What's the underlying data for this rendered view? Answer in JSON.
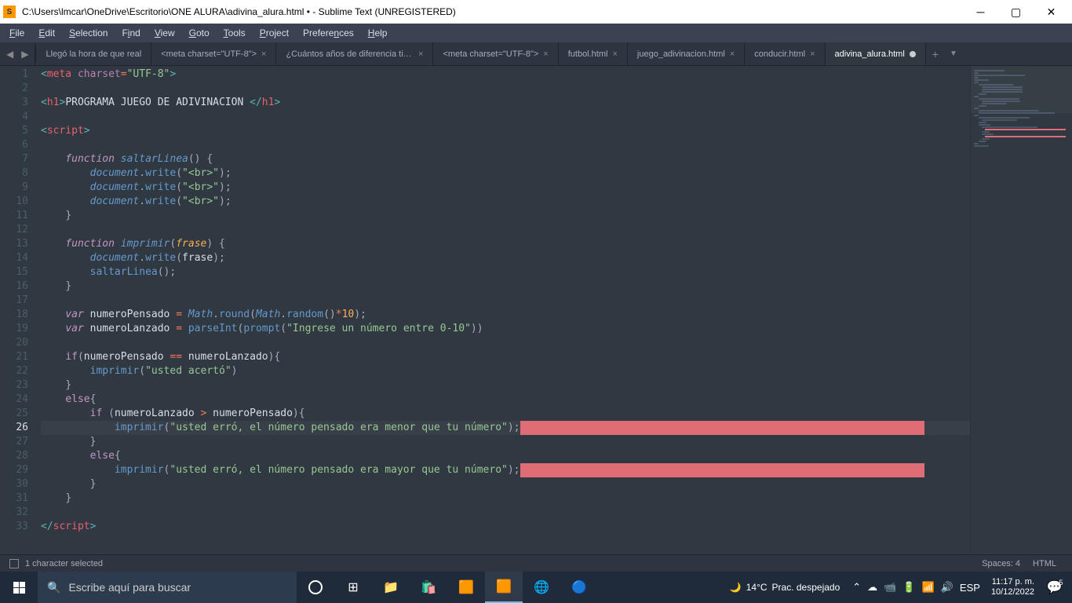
{
  "titlebar": {
    "path": "C:\\Users\\lmcar\\OneDrive\\Escritorio\\ONE ALURA\\adivina_alura.html • - Sublime Text (UNREGISTERED)"
  },
  "menu": [
    "File",
    "Edit",
    "Selection",
    "Find",
    "View",
    "Goto",
    "Tools",
    "Project",
    "Preferences",
    "Help"
  ],
  "tabs": [
    {
      "label": "Llegó la hora de que real",
      "close": false
    },
    {
      "label": "<meta charset=\"UTF-8\">",
      "close": true
    },
    {
      "label": "¿Cuántos años de diferencia tienes con tu hermano?",
      "close": true
    },
    {
      "label": "<meta charset=\"UTF-8\">",
      "close": true
    },
    {
      "label": "futbol.html",
      "close": true
    },
    {
      "label": "juego_adivinacion.html",
      "close": true
    },
    {
      "label": "conducir.html",
      "close": true
    },
    {
      "label": "adivina_alura.html",
      "dirty": true,
      "active": true
    }
  ],
  "lines": 33,
  "current_line": 26,
  "code": {
    "l1_meta": {
      "tag": "meta",
      "attr": "charset",
      "val": "\"UTF-8\""
    },
    "l3_h1": {
      "open": "h1",
      "text": "PROGRAMA JUEGO DE ADIVINACION ",
      "close": "h1"
    },
    "l5_script": "script",
    "l7_func": {
      "kw": "function",
      "name": "saltarLinea"
    },
    "l8_10": {
      "obj": "document",
      "method": "write",
      "arg": "\"<br>\""
    },
    "l13_func": {
      "kw": "function",
      "name": "imprimir",
      "param": "frase"
    },
    "l14": {
      "obj": "document",
      "method": "write",
      "arg": "frase"
    },
    "l15": {
      "call": "saltarLinea"
    },
    "l18": {
      "kw": "var",
      "name": "numeroPensado",
      "math": "Math",
      "round": "round",
      "random": "random",
      "num": "10"
    },
    "l19": {
      "kw": "var",
      "name": "numeroLanzado",
      "parse": "parseInt",
      "prompt": "prompt",
      "str": "\"Ingrese un número entre 0-10\""
    },
    "l21_if": {
      "kw": "if",
      "a": "numeroPensado",
      "op": "==",
      "b": "numeroLanzado"
    },
    "l22": {
      "call": "imprimir",
      "str": "\"usted acertó\""
    },
    "l24_else": "else",
    "l25_if": {
      "kw": "if",
      "a": "numeroLanzado",
      "op": ">",
      "b": "numeroPensado"
    },
    "l26": {
      "call": "imprimir",
      "str": "\"usted erró, el número pensado era menor que tu número\""
    },
    "l28_else": "else",
    "l29": {
      "call": "imprimir",
      "str": "\"usted erró, el número pensado era mayor que tu número\""
    },
    "l33": "script"
  },
  "status": {
    "selection": "1 character selected",
    "spaces": "Spaces: 4",
    "syntax": "HTML"
  },
  "taskbar": {
    "search_placeholder": "Escribe aquí para buscar",
    "weather_temp": "14°C",
    "weather_desc": "Prac. despejado",
    "lang": "ESP",
    "time": "11:17 p. m.",
    "date": "10/12/2022",
    "notif_count": "5"
  }
}
